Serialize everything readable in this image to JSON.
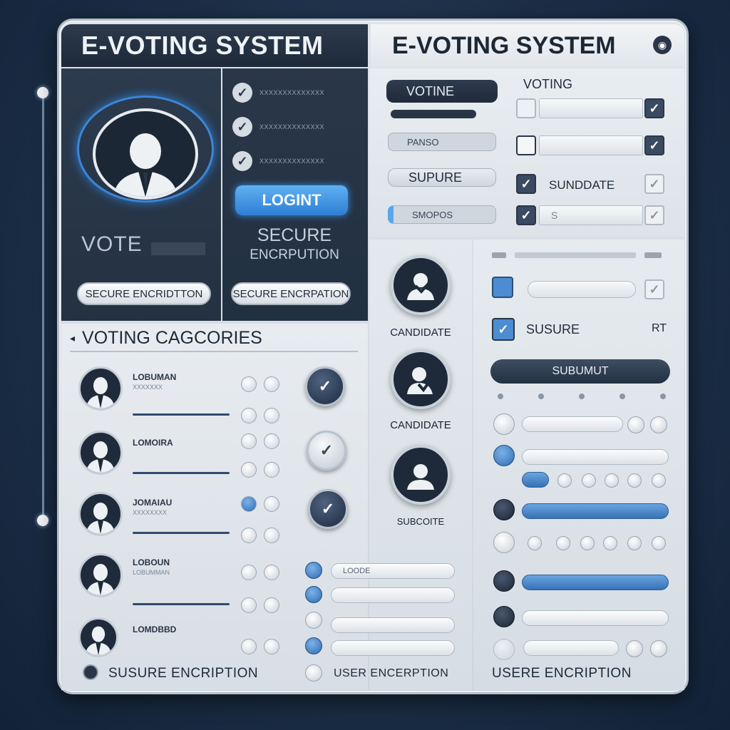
{
  "header": {
    "title_left": "E-VOTING SYSTEM",
    "title_right": "E-VOTING SYSTEM",
    "title_icon": "dot-circle-icon"
  },
  "login_panel": {
    "vote_label": "VOTE",
    "checklist": [
      {
        "text": "XXXXXXXXXXXXXX"
      },
      {
        "text": "XXXXXXXXXXXXXX"
      },
      {
        "text": "XXXXXXXXXXXXXX"
      }
    ],
    "login_button": "LOGINT",
    "secure_line1": "SECURE",
    "secure_line2": "ENCRPUTION",
    "pill_left": "SECURE ENCRIDTTON",
    "pill_right": "SECURE ENCRPATION"
  },
  "voting_panel": {
    "tag_votine": "VOTINE",
    "voting_label": "VOTING",
    "pill_2": "PANSO",
    "tag_supure": "SUPURE",
    "sundidate_label": "SUNDDATE",
    "pill_4": "SMOPOS",
    "s_label": "S"
  },
  "candidates": [
    {
      "label": "CANDIDATE"
    },
    {
      "label": "CANDIDATE"
    },
    {
      "label": "SUBCOITE"
    }
  ],
  "right_panel": {
    "sure_label": "SUSURE",
    "rt_label": "RT",
    "submit_button": "SUBUMUT",
    "footer": "USERE ENCRIPTION"
  },
  "categories": {
    "title": "VOTING CAGCORIES",
    "items": [
      {
        "name": "LOBUMAN",
        "sub": "XXXXXXX"
      },
      {
        "name": "LOMOIRA",
        "sub": ""
      },
      {
        "name": "JOMAIAU",
        "sub": "XXXXXXXX"
      },
      {
        "name": "LOBOUN",
        "sub": "LOBUMMAN"
      },
      {
        "name": "LOMDBBD",
        "sub": ""
      }
    ],
    "footer_left": "SUSURE ENCRIPTION",
    "footer_mid": "USER ENCERPTION",
    "list_label": "LOODE"
  },
  "colors": {
    "accent": "#3a86d6",
    "dark": "#233142",
    "light": "#e4e9ee"
  }
}
